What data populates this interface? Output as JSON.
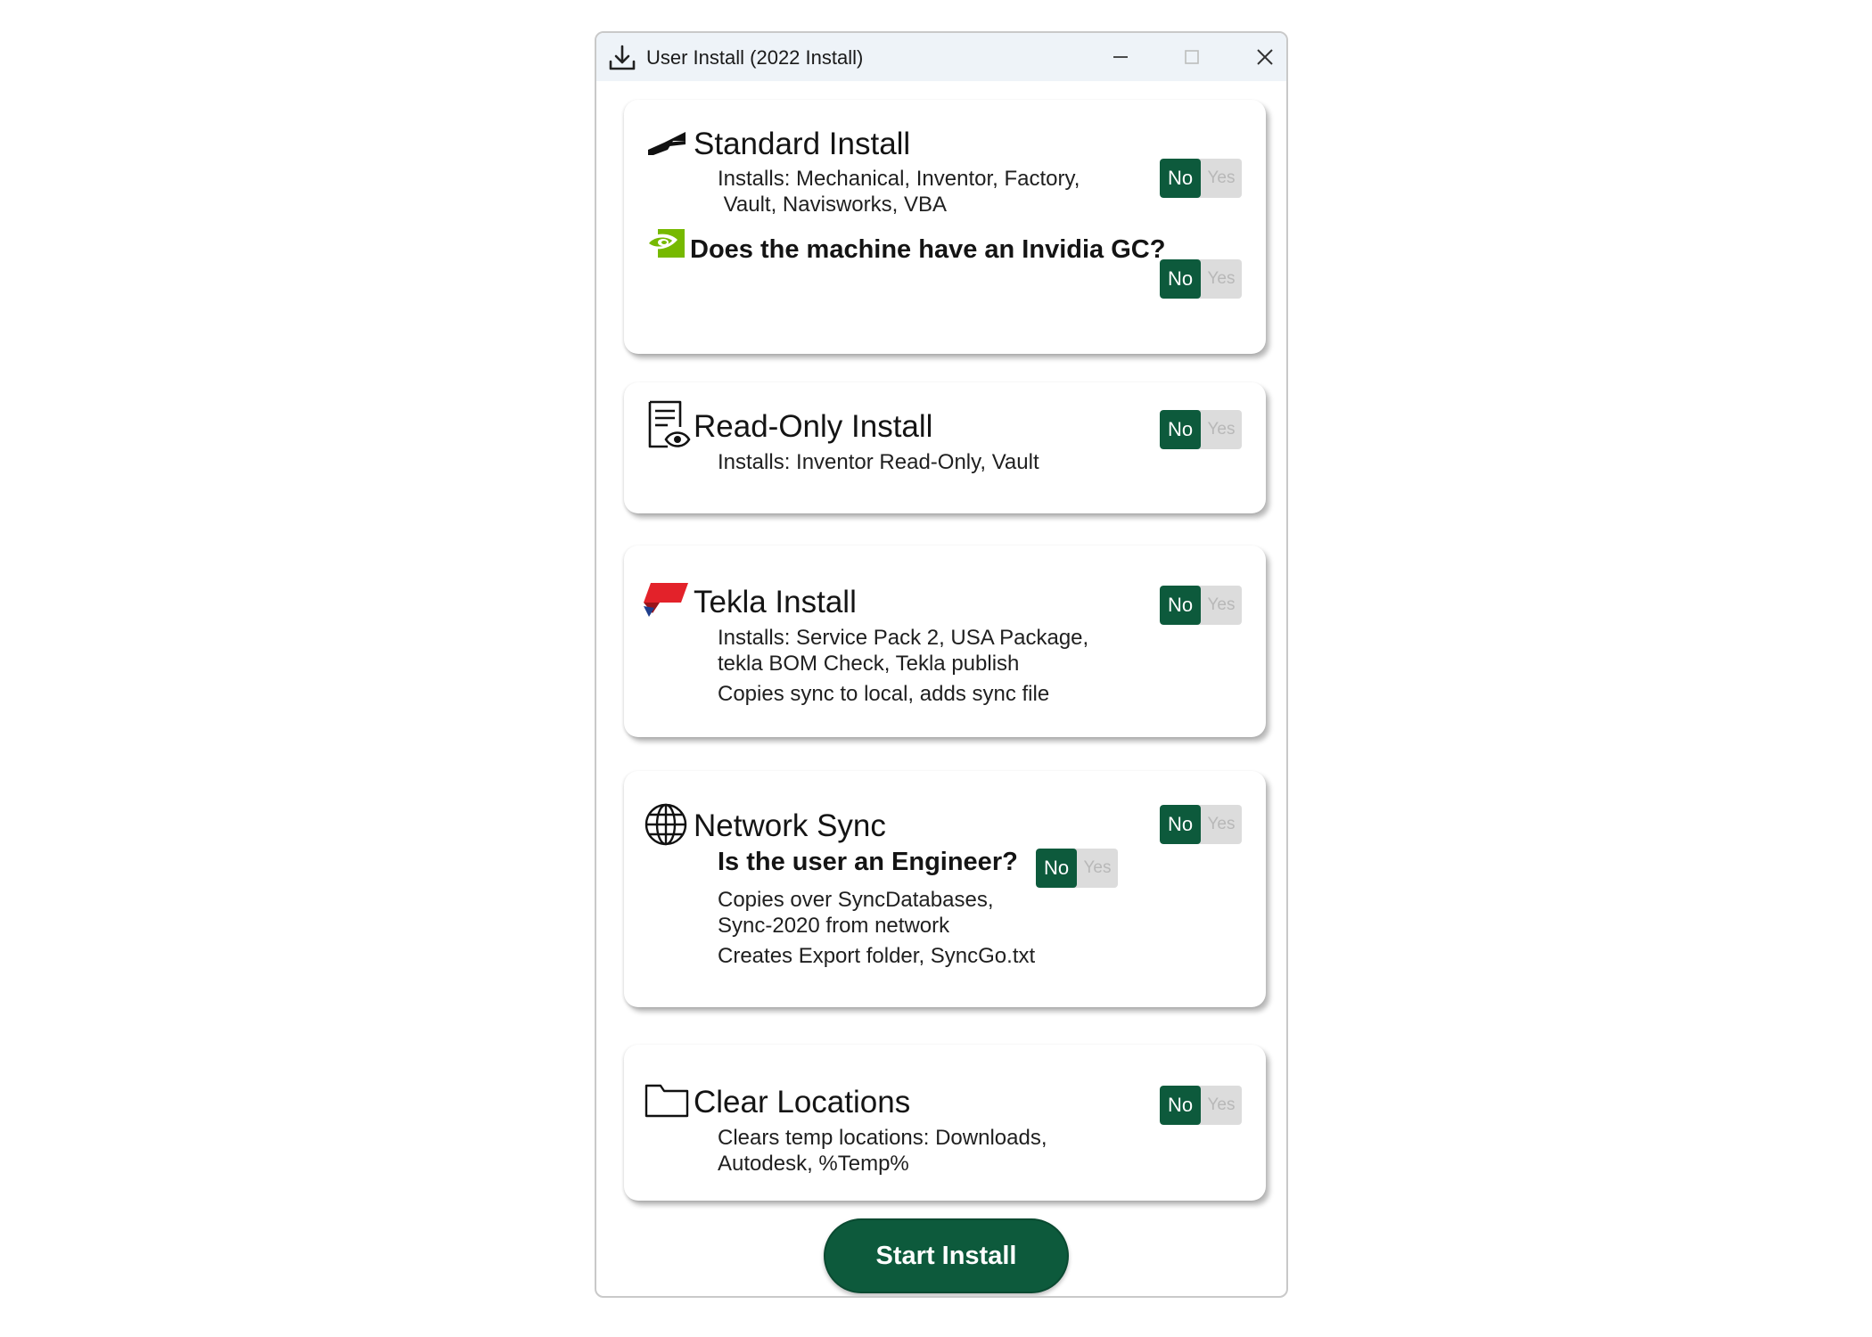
{
  "window": {
    "title": "User Install (2022 Install)"
  },
  "toggle": {
    "no_label": "No",
    "yes_label": "Yes",
    "accent": "#0d5a3c"
  },
  "cards": {
    "standard": {
      "title": "Standard Install",
      "desc_line1": "Installs: Mechanical, Inventor, Factory,",
      "desc_line2": " Vault, Navisworks, VBA",
      "question": "Does the machine have an Invidia GC?",
      "icon": "autodesk-logo-icon",
      "question_icon": "nvidia-logo-icon",
      "selected": "No",
      "question_selected": "No"
    },
    "readonly": {
      "title": "Read-Only Install",
      "desc_line1": "Installs: Inventor Read-Only, Vault",
      "icon": "document-view-icon",
      "selected": "No"
    },
    "tekla": {
      "title": "Tekla Install",
      "desc_line1": "Installs: Service Pack 2, USA Package,",
      "desc_line2": "tekla BOM Check, Tekla publish",
      "desc_line3": "Copies sync to local, adds sync file",
      "icon": "tekla-logo-icon",
      "selected": "No"
    },
    "network": {
      "title": "Network Sync",
      "question": "Is the user an Engineer?",
      "desc_line1": "Copies over SyncDatabases,",
      "desc_line2": "Sync-2020 from network",
      "desc_line3": "Creates Export folder, SyncGo.txt",
      "icon": "globe-icon",
      "selected": "No",
      "question_selected": "No"
    },
    "clear": {
      "title": "Clear Locations",
      "desc_line1": "Clears temp locations: Downloads,",
      "desc_line2": "Autodesk, %Temp%",
      "icon": "folder-icon",
      "selected": "No"
    }
  },
  "start_button": "Start Install"
}
